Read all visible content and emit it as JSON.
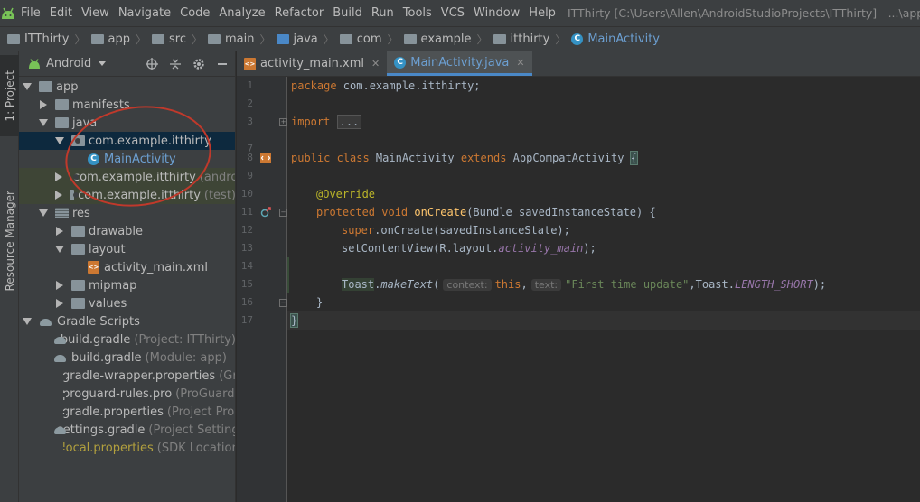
{
  "menubar": {
    "items": [
      "File",
      "Edit",
      "View",
      "Navigate",
      "Code",
      "Analyze",
      "Refactor",
      "Build",
      "Run",
      "Tools",
      "VCS",
      "Window",
      "Help"
    ],
    "window_title": "ITThirty [C:\\Users\\Allen\\AndroidStudioProjects\\ITThirty] - ...\\app\\src\\ma"
  },
  "breadcrumb": [
    "ITThirty",
    "app",
    "src",
    "main",
    "java",
    "com",
    "example",
    "itthirty",
    "MainActivity"
  ],
  "left_strip": {
    "project_tab": "1: Project",
    "resource_tab": "Resource Manager"
  },
  "project_panel": {
    "view_selector": "Android",
    "tree": [
      {
        "label": "app",
        "hint": ""
      },
      {
        "label": "manifests",
        "hint": ""
      },
      {
        "label": "java",
        "hint": ""
      },
      {
        "label": "com.example.itthirty",
        "hint": ""
      },
      {
        "label": "MainActivity",
        "hint": ""
      },
      {
        "label": "com.example.itthirty",
        "hint": "(androidTest)"
      },
      {
        "label": "com.example.itthirty",
        "hint": "(test)"
      },
      {
        "label": "res",
        "hint": ""
      },
      {
        "label": "drawable",
        "hint": ""
      },
      {
        "label": "layout",
        "hint": ""
      },
      {
        "label": "activity_main.xml",
        "hint": ""
      },
      {
        "label": "mipmap",
        "hint": ""
      },
      {
        "label": "values",
        "hint": ""
      },
      {
        "label": "Gradle Scripts",
        "hint": ""
      },
      {
        "label": "build.gradle",
        "hint": "(Project: ITThirty)"
      },
      {
        "label": "build.gradle",
        "hint": "(Module: app)"
      },
      {
        "label": "gradle-wrapper.properties",
        "hint": "(Gradle Version)"
      },
      {
        "label": "proguard-rules.pro",
        "hint": "(ProGuard Rules for app)"
      },
      {
        "label": "gradle.properties",
        "hint": "(Project Properties)"
      },
      {
        "label": "settings.gradle",
        "hint": "(Project Settings)"
      },
      {
        "label": "local.properties",
        "hint": "(SDK Location)"
      }
    ]
  },
  "editor": {
    "tabs": [
      "activity_main.xml",
      "MainActivity.java"
    ],
    "line_numbers": [
      "1",
      "2",
      "3",
      "7",
      "8",
      "9",
      "10",
      "11",
      "12",
      "13",
      "14",
      "15",
      "16",
      "17"
    ],
    "code": {
      "l1_kw": "package",
      "l1_rest": " com.example.itthirty;",
      "l3_kw": "import",
      "l3_fold": "...",
      "l8_kw1": "public class",
      "l8_name": " MainActivity ",
      "l8_kw2": "extends",
      "l8_super": " AppCompatActivity ",
      "l8_brace": "{",
      "l10_ann": "@Override",
      "l11_kw": "protected void",
      "l11_method": "onCreate",
      "l11_rest": "(Bundle savedInstanceState) {",
      "l12_kw": "super",
      "l12_rest": ".onCreate(savedInstanceState);",
      "l13_a": "setContentView(R.layout.",
      "l13_field": "activity_main",
      "l13_b": ");",
      "l15_toast": "Toast",
      "l15_dot": ".",
      "l15_method": "makeText",
      "l15_paren": "(",
      "l15_hint1": "context:",
      "l15_this": "this",
      "l15_comma": ",",
      "l15_hint2": "text:",
      "l15_str": "\"First time update\"",
      "l15_toast2": ",Toast.",
      "l15_const": "LENGTH_SHORT",
      "l15_end": ");",
      "l16": "}",
      "l17": "}"
    }
  }
}
